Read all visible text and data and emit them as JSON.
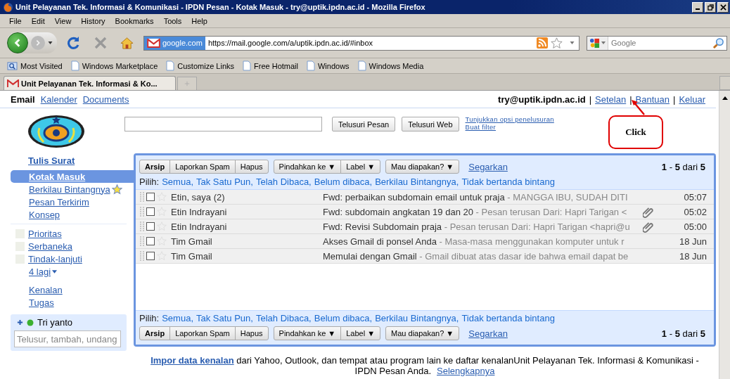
{
  "window": {
    "title": "Unit Pelayanan Tek. Informasi & Komunikasi - IPDN Pesan - Kotak Masuk - try@uptik.ipdn.ac.id - Mozilla Firefox"
  },
  "menu": [
    "File",
    "Edit",
    "View",
    "History",
    "Bookmarks",
    "Tools",
    "Help"
  ],
  "address_bar": {
    "site_badge": "google.com",
    "url": "https://mail.google.com/a/uptik.ipdn.ac.id/#inbox"
  },
  "search_bar": {
    "placeholder": "Google"
  },
  "bookmarks": [
    {
      "label": "Most Visited",
      "kind": "folder"
    },
    {
      "label": "Windows Marketplace",
      "kind": "page"
    },
    {
      "label": "Customize Links",
      "kind": "page"
    },
    {
      "label": "Free Hotmail",
      "kind": "page"
    },
    {
      "label": "Windows",
      "kind": "page"
    },
    {
      "label": "Windows Media",
      "kind": "page"
    }
  ],
  "tabs": [
    {
      "label": "Unit Pelayanan Tek. Informasi & Ko...",
      "selected": true
    }
  ],
  "top_nav": {
    "apps": [
      {
        "label": "Email",
        "selected": true
      },
      {
        "label": "Kalender",
        "selected": false
      },
      {
        "label": "Documents",
        "selected": false
      }
    ],
    "account": "try@uptik.ipdn.ac.id",
    "links": [
      {
        "separator": "|",
        "label": "Setelan"
      },
      {
        "separator": "|",
        "label": "Bantuan"
      },
      {
        "separator": "|",
        "label": "Keluar"
      }
    ]
  },
  "search": {
    "buttons": [
      "Telusuri Pesan",
      "Telusuri Web"
    ],
    "links": [
      "Tunjukkan opsi penelusuran",
      "Buat filter"
    ]
  },
  "callout": {
    "text": "Click"
  },
  "sidebar": {
    "compose": "Tulis Surat",
    "folders": [
      {
        "label": "Kotak Masuk",
        "selected": true,
        "kind": "plain"
      },
      {
        "label": "Berkilau Bintangnya",
        "selected": false,
        "kind": "starred"
      },
      {
        "label": "Pesan Terkirim",
        "selected": false,
        "kind": "plain"
      },
      {
        "label": "Konsep",
        "selected": false,
        "kind": "plain"
      }
    ],
    "labels": [
      "Prioritas",
      "Serbaneka",
      "Tindak-lanjuti"
    ],
    "more": "4 lagi",
    "links": [
      "Kenalan",
      "Tugas"
    ],
    "chat": {
      "user": "Tri yanto",
      "online": true,
      "placeholder": "Telusur, tambah, undang"
    }
  },
  "inbox": {
    "top": {
      "buttons": [
        {
          "label": "Arsip",
          "kind": "primary"
        },
        {
          "label": "Laporkan Spam",
          "kind": "plain"
        },
        {
          "label": "Hapus",
          "kind": "plain"
        }
      ],
      "menus": [
        "Pindahkan ke ▼",
        "Label ▼",
        "Mau diapakan? ▼"
      ],
      "refresh": "Segarkan",
      "count": "**1** - **5** dari **5**",
      "select_label": "Pilih:",
      "select_options": [
        "Semua,",
        "Tak Satu Pun,",
        "Telah Dibaca,",
        "Belum dibaca,",
        "Berkilau Bintangnya,",
        "Tidak bertanda bintang"
      ]
    },
    "rows": [
      {
        "sender": "Etin, saya (2)",
        "subject": "Fwd: perbaikan subdomain email untuk praja",
        "snippet": "- MANGGA IBU, SUDAH DITI",
        "attachment": false,
        "checked": false,
        "starred": false,
        "time": "05:07"
      },
      {
        "sender": "Etin Indrayani",
        "subject": "Fwd: subdomain angkatan 19 dan 20",
        "snippet": "- Pesan terusan Dari: Hapri Tarigan <",
        "attachment": true,
        "checked": false,
        "starred": false,
        "time": "05:02"
      },
      {
        "sender": "Etin Indrayani",
        "subject": "Fwd: Revisi Subdomain praja",
        "snippet": "- Pesan terusan Dari: Hapri Tarigan <hapri@u",
        "attachment": true,
        "checked": false,
        "starred": false,
        "time": "05:00"
      },
      {
        "sender": "Tim Gmail",
        "subject": "Akses Gmail di ponsel Anda",
        "snippet": "- Masa-masa menggunakan komputer untuk r",
        "attachment": false,
        "checked": false,
        "starred": false,
        "time": "18 Jun"
      },
      {
        "sender": "Tim Gmail",
        "subject": "Memulai dengan Gmail",
        "snippet": "- Gmail dibuat atas dasar ide bahwa email dapat be",
        "attachment": false,
        "checked": false,
        "starred": false,
        "time": "18 Jun"
      }
    ],
    "bottom": {
      "select_label": "Pilih:",
      "select_options": [
        "Semua,",
        "Tak Satu Pun,",
        "Telah Dibaca,",
        "Belum dibaca,",
        "Berkilau Bintangnya,",
        "Tidak bertanda bintang"
      ],
      "buttons": [
        {
          "label": "Arsip",
          "kind": "primary"
        },
        {
          "label": "Laporkan Spam",
          "kind": "plain"
        },
        {
          "label": "Hapus",
          "kind": "plain"
        }
      ],
      "menus": [
        "Pindahkan ke ▼",
        "Label ▼",
        "Mau diapakan? ▼"
      ],
      "refresh": "Segarkan",
      "count": "**1** - **5** dari **5**"
    }
  },
  "footer": {
    "link": "Impor data kenalan",
    "text": " dari Yahoo, Outlook, dan tempat atau program lain ke daftar kenalanUnit Pelayanan Tek. Informasi & Komunikasi - IPDN Pesan Anda.",
    "more": "Selengkapnya"
  }
}
